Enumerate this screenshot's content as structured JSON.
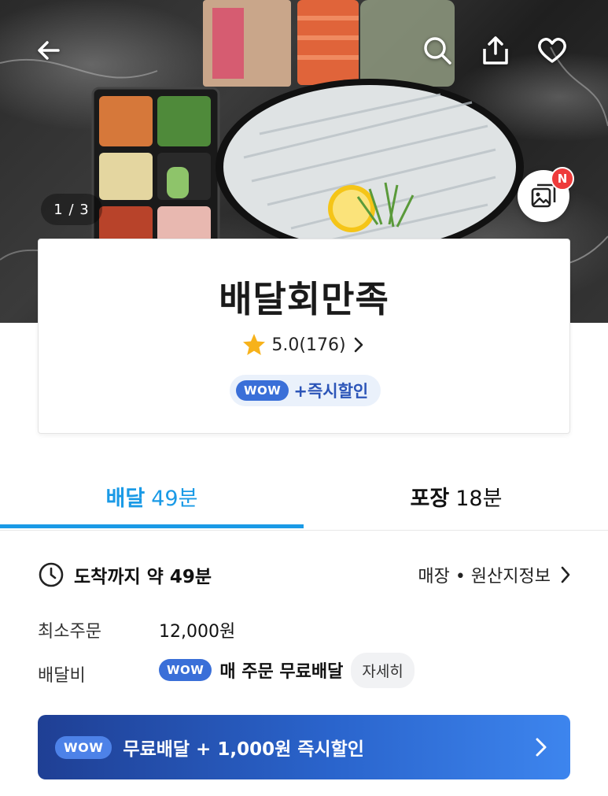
{
  "hero": {
    "image_counter": "1 / 3",
    "new_badge": "N",
    "icons": {
      "back": "back-arrow-icon",
      "search": "search-icon",
      "share": "share-icon",
      "favorite": "heart-icon",
      "gallery": "photo-gallery-icon"
    }
  },
  "store": {
    "name": "배달회만족",
    "rating": "5.0(176)",
    "wow_label": "WOW",
    "wow_promo": "+즉시할인"
  },
  "tabs": {
    "delivery": {
      "label": "배달",
      "time": "49분"
    },
    "pickup": {
      "label": "포장",
      "time": "18분"
    },
    "active": "delivery"
  },
  "eta": {
    "text": "도착까지 약 49분",
    "store_info_link": "매장 • 원산지정보"
  },
  "info": {
    "min_order_label": "최소주문",
    "min_order_value": "12,000원",
    "delivery_fee_label": "배달비",
    "wow_label": "WOW",
    "delivery_fee_text": "매 주문 무료배달",
    "detail_button": "자세히"
  },
  "banner": {
    "wow_label": "WOW",
    "text": "무료배달 + 1,000원 즉시할인"
  },
  "colors": {
    "accent_blue": "#1a9ae6",
    "wow_blue": "#3a6fd8",
    "banner_start": "#1f3f94",
    "banner_end": "#3d85ee",
    "badge_red": "#ee3b3b"
  }
}
